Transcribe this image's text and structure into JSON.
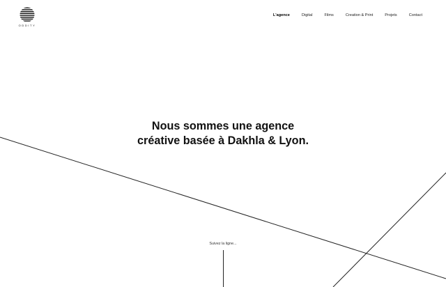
{
  "logo": {
    "wordmark": "ODDITY"
  },
  "nav": {
    "items": [
      {
        "label": "L'agence",
        "active": true
      },
      {
        "label": "Digital",
        "active": false
      },
      {
        "label": "Films",
        "active": false
      },
      {
        "label": "Creation & Print",
        "active": false
      },
      {
        "label": "Projets",
        "active": false
      },
      {
        "label": "Contact",
        "active": false
      }
    ]
  },
  "hero": {
    "line1": "Nous sommes une agence",
    "line2": "créative basée à Dakhla & Lyon."
  },
  "scroll": {
    "label": "Suivez la ligne..."
  },
  "colors": {
    "text": "#111111",
    "background": "#ffffff",
    "line": "#222222"
  }
}
